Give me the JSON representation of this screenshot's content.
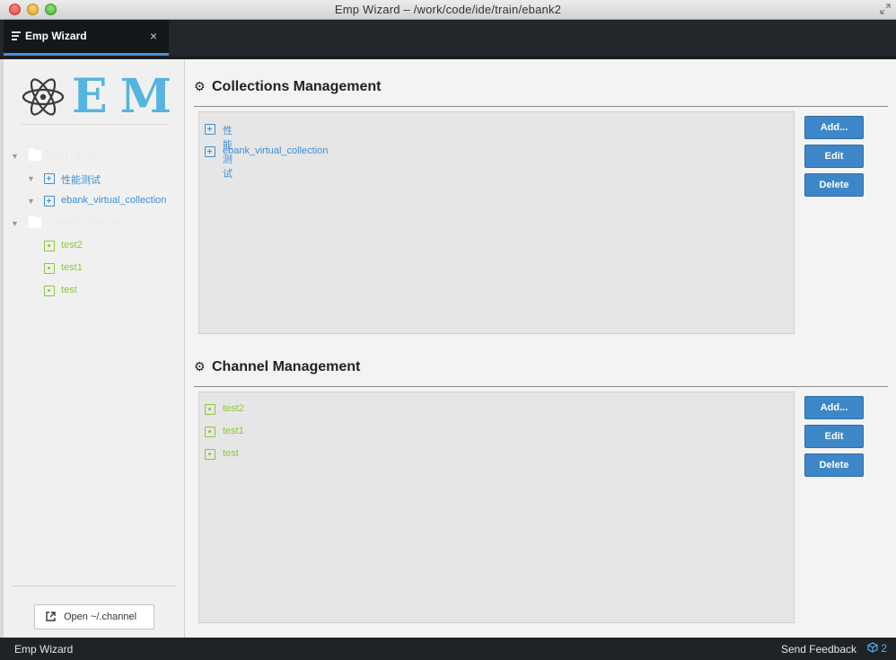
{
  "window": {
    "title": "Emp Wizard – /work/code/ide/train/ebank2"
  },
  "tab": {
    "label": "Emp Wizard",
    "close_glyph": "×"
  },
  "sidebar": {
    "logo_text": "EMP",
    "tree": {
      "channel_list_label": "Channel List",
      "collections": [
        {
          "label": "性能测试"
        },
        {
          "label": "ebank_virtual_collection"
        }
      ],
      "unused_channel_label": "Unused Channel",
      "unused_channels": [
        {
          "label": "test2"
        },
        {
          "label": "test1"
        },
        {
          "label": "test"
        }
      ]
    },
    "open_button_label": "Open ~/.channel"
  },
  "collections_section": {
    "title": "Collections Management",
    "items": [
      {
        "label": "性能测试"
      },
      {
        "label": "ebank_virtual_collection"
      }
    ],
    "add_label": "Add...",
    "edit_label": "Edit",
    "delete_label": "Delete"
  },
  "channel_section": {
    "title": "Channel Management",
    "items": [
      {
        "label": "test2"
      },
      {
        "label": "test1"
      },
      {
        "label": "test"
      }
    ],
    "add_label": "Add...",
    "edit_label": "Edit",
    "delete_label": "Delete"
  },
  "statusbar": {
    "left_label": "Emp Wizard",
    "feedback_label": "Send Feedback",
    "package_count": "2"
  },
  "colors": {
    "accent_blue": "#3d87c8",
    "collection_blue": "#3d8fd6",
    "channel_green": "#8dc63f",
    "logo_blue": "#56b4e0"
  }
}
